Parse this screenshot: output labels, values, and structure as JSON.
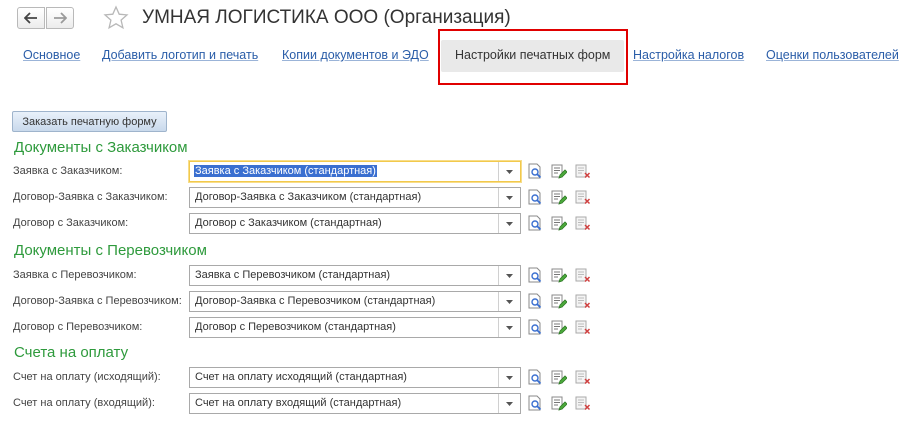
{
  "window": {
    "title": "УМНАЯ ЛОГИСТИКА ООО (Организация)"
  },
  "tabs": [
    {
      "label": "Основное"
    },
    {
      "label": "Добавить логотип и печать"
    },
    {
      "label": "Копии документов и ЭДО"
    },
    {
      "label": "Настройки печатных форм",
      "active": true
    },
    {
      "label": "Настройка налогов"
    },
    {
      "label": "Оценки пользователей"
    }
  ],
  "order_button": "Заказать печатную форму",
  "sections": [
    {
      "title": "Документы с Заказчиком",
      "rows": [
        {
          "label": "Заявка с Заказчиком:",
          "value": "Заявка с Заказчиком (стандартная)"
        },
        {
          "label": "Договор-Заявка с Заказчиком:",
          "value": "Договор-Заявка с Заказчиком (стандартная)"
        },
        {
          "label": "Договор с Заказчиком:",
          "value": "Договор с Заказчиком (стандартная)"
        }
      ]
    },
    {
      "title": "Документы с Перевозчиком",
      "rows": [
        {
          "label": "Заявка с Перевозчиком:",
          "value": "Заявка с Перевозчиком (стандартная)"
        },
        {
          "label": "Договор-Заявка с Перевозчиком:",
          "value": "Договор-Заявка с Перевозчиком (стандартная)"
        },
        {
          "label": "Договор с Перевозчиком:",
          "value": "Договор с Перевозчиком (стандартная)"
        }
      ]
    },
    {
      "title": "Счета на оплату",
      "rows": [
        {
          "label": "Счет на оплату (исходящий):",
          "value": "Счет на оплату исходящий (стандартная)"
        },
        {
          "label": "Счет на оплату (входящий):",
          "value": "Счет на оплату входящий (стандартная)"
        }
      ]
    }
  ],
  "row_actions": [
    "preview-icon",
    "edit-icon",
    "delete-icon"
  ],
  "colors": {
    "section_title": "#2e9a3c",
    "link": "#2a5da8",
    "highlight_frame": "#e00000",
    "focus": "#f2c94c",
    "selection": "#3a6fd0"
  }
}
